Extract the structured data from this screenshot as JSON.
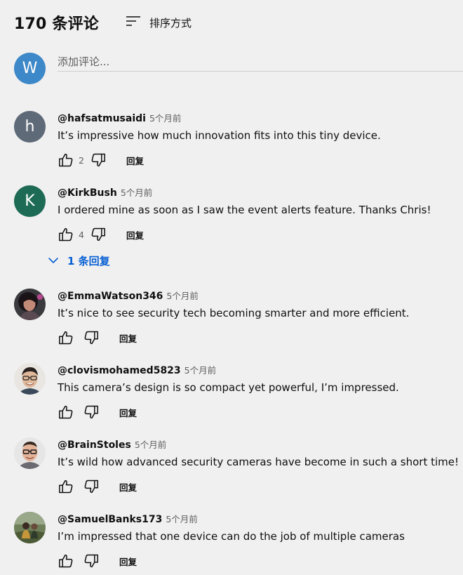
{
  "header": {
    "comment_count": "170 条评论",
    "sort_label": "排序方式"
  },
  "add_comment": {
    "avatar_letter": "W",
    "avatar_color": "#3d88c8",
    "placeholder": "添加评论..."
  },
  "comments": [
    {
      "author": "@hafsatmusaidi",
      "time": "5个月前",
      "text": "It’s impressive how much innovation fits into this tiny device.",
      "likes": "2",
      "reply_label": "回复",
      "avatar_letter": "h",
      "avatar_color": "#5e6a78"
    },
    {
      "author": "@KirkBush",
      "time": "5个月前",
      "text": "I ordered mine as soon as I saw the event alerts feature. Thanks Chris!",
      "likes": "4",
      "reply_label": "回复",
      "avatar_letter": "K",
      "avatar_color": "#1e6b55"
    },
    {
      "author": "@EmmaWatson346",
      "time": "5个月前",
      "text": "It’s nice to see security tech becoming smarter and more efficient.",
      "likes": "",
      "reply_label": "回复"
    },
    {
      "author": "@clovismohamed5823",
      "time": "5个月前",
      "text": "This camera’s design is so compact yet powerful, I’m impressed.",
      "likes": "",
      "reply_label": "回复"
    },
    {
      "author": "@BrainStoles",
      "time": "5个月前",
      "text": "It’s wild how advanced security cameras have become in such a short time!",
      "likes": "",
      "reply_label": "回复"
    },
    {
      "author": "@SamuelBanks173",
      "time": "5个月前",
      "text": "I’m impressed that one device can do the job of multiple cameras",
      "likes": "",
      "reply_label": "回复"
    }
  ],
  "replies_toggle": {
    "label": "1 条回复"
  },
  "colors": {
    "link_blue": "#065fd4",
    "background": "#f0f0f0",
    "secondary_text": "#606060"
  },
  "icons": {
    "sort": "sort-lines-icon",
    "like": "thumbs-up-icon",
    "dislike": "thumbs-down-icon",
    "expand": "chevron-down-icon"
  }
}
